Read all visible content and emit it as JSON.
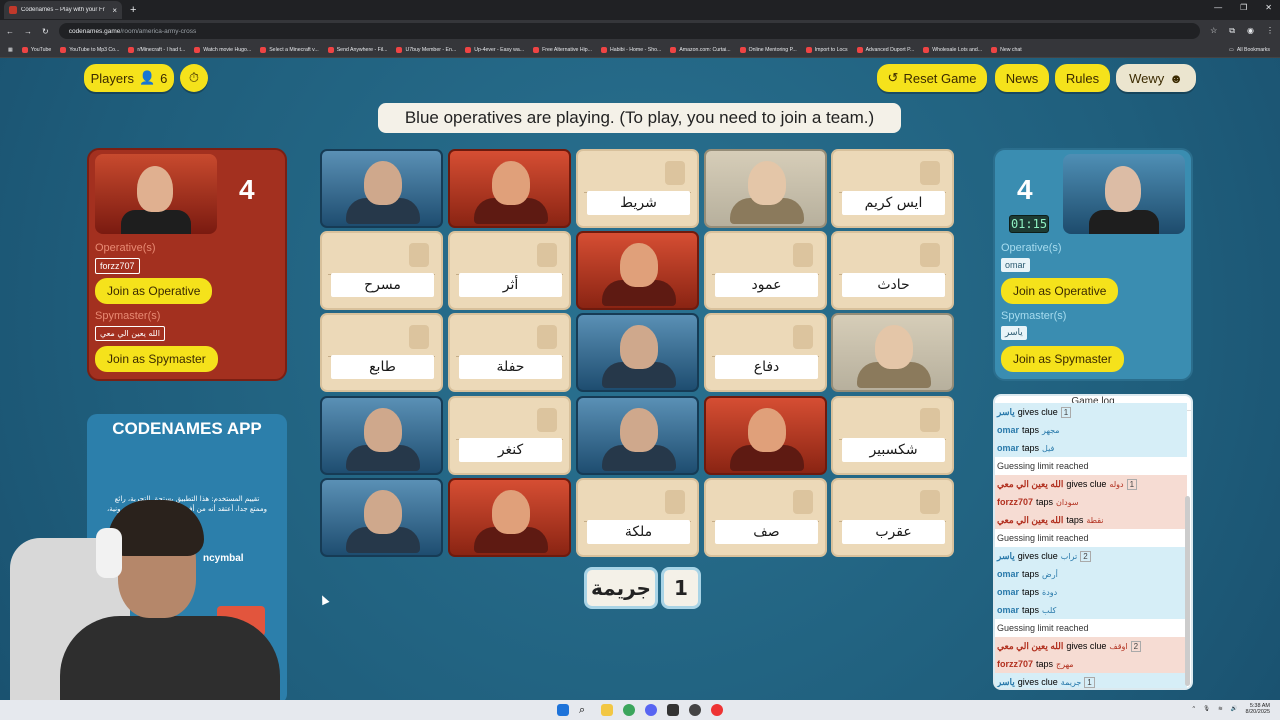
{
  "browser": {
    "tab_title": "Codenames – Play with your Fr",
    "url_host": "codenames.game",
    "url_path": "/room/america-army-cross",
    "bookmarks": [
      "YouTube",
      "YouTube to Mp3 Co...",
      "r/Minecraft - I had t...",
      "Watch movie Hugo...",
      "Select a Minecraft v...",
      "Send Anywhere - Fil...",
      "U7buy Member - En...",
      "Up-4ever - Easy wa...",
      "Free Alternative Hip...",
      "Habibi - Home - Sho...",
      "Amazon.com: Curtai...",
      "Online Mentoring P...",
      "Import to Locs",
      "Advanced Duport P...",
      "Wholesale Lots and...",
      "New chat"
    ],
    "all_bookmarks": "All Bookmarks"
  },
  "header": {
    "players_label": "Players",
    "players_count": "6",
    "reset_label": "Reset Game",
    "news_label": "News",
    "rules_label": "Rules",
    "user_label": "Wewy"
  },
  "status_message": "Blue operatives are playing. (To play, you need to join a team.)",
  "red_team": {
    "score": "4",
    "operatives_label": "Operative(s)",
    "operative": "forzz707",
    "join_operative": "Join as Operative",
    "spymaster_label": "Spymaster(s)",
    "spymaster": "الله يعين الي معي",
    "join_spymaster": "Join as Spymaster"
  },
  "blue_team": {
    "score": "4",
    "timer": "01:15",
    "operatives_label": "Operative(s)",
    "operative": "omar",
    "join_operative": "Join as Operative",
    "spymaster_label": "Spymaster(s)",
    "spymaster": "ياسر",
    "join_spymaster": "Join as Spymaster"
  },
  "app_ad": {
    "title": "CODENAMES APP",
    "description": "تقييم المستخدم: هذا التطبيق يستحق التجربة، رائع وممتع جدا، أعتقد أنه من أفضل ألعاب الورق الإلكترونية، أكثر",
    "credit": "ncymbal"
  },
  "cards": [
    {
      "type": "agent-blue",
      "word": ""
    },
    {
      "type": "agent-red",
      "word": ""
    },
    {
      "type": "word",
      "word": "شريط"
    },
    {
      "type": "bystander",
      "word": ""
    },
    {
      "type": "word",
      "word": "ايس كريم"
    },
    {
      "type": "word",
      "word": "مسرح"
    },
    {
      "type": "word",
      "word": "أثر"
    },
    {
      "type": "agent-red",
      "word": ""
    },
    {
      "type": "word",
      "word": "عمود"
    },
    {
      "type": "word",
      "word": "حادث"
    },
    {
      "type": "word",
      "word": "طابع"
    },
    {
      "type": "word",
      "word": "حفلة"
    },
    {
      "type": "agent-blue",
      "word": ""
    },
    {
      "type": "word",
      "word": "دفاع"
    },
    {
      "type": "bystander",
      "word": ""
    },
    {
      "type": "agent-blue",
      "word": ""
    },
    {
      "type": "word",
      "word": "كنغر"
    },
    {
      "type": "agent-blue",
      "word": ""
    },
    {
      "type": "agent-red",
      "word": ""
    },
    {
      "type": "word",
      "word": "شكسبير"
    },
    {
      "type": "agent-blue",
      "word": ""
    },
    {
      "type": "agent-red",
      "word": ""
    },
    {
      "type": "word",
      "word": "ملكة"
    },
    {
      "type": "word",
      "word": "صف"
    },
    {
      "type": "word",
      "word": "عقرب"
    }
  ],
  "clue": {
    "word": "جريمة",
    "number": "1"
  },
  "game_log": {
    "title": "Game log",
    "entries": [
      {
        "team": "blue",
        "player": "ياسر",
        "action": "gives clue",
        "word": "",
        "num": "1"
      },
      {
        "team": "blue",
        "player": "omar",
        "action": "taps",
        "word": "مجهر",
        "num": ""
      },
      {
        "team": "blue",
        "player": "omar",
        "action": "taps",
        "word": "فيل",
        "num": ""
      },
      {
        "team": "neutral",
        "player": "",
        "action": "Guessing limit reached",
        "word": "",
        "num": ""
      },
      {
        "team": "red",
        "player": "الله يعين الي معي",
        "action": "gives clue",
        "word": "دوله",
        "num": "1"
      },
      {
        "team": "red",
        "player": "forzz707",
        "action": "taps",
        "word": "سودان",
        "num": ""
      },
      {
        "team": "red",
        "player": "الله يعين الي معي",
        "action": "taps",
        "word": "نقطة",
        "num": ""
      },
      {
        "team": "neutral",
        "player": "",
        "action": "Guessing limit reached",
        "word": "",
        "num": ""
      },
      {
        "team": "blue",
        "player": "ياسر",
        "action": "gives clue",
        "word": "تراب",
        "num": "2"
      },
      {
        "team": "blue",
        "player": "omar",
        "action": "taps",
        "word": "أرض",
        "num": ""
      },
      {
        "team": "blue",
        "player": "omar",
        "action": "taps",
        "word": "دودة",
        "num": ""
      },
      {
        "team": "blue",
        "player": "omar",
        "action": "taps",
        "word": "كلب",
        "num": ""
      },
      {
        "team": "neutral",
        "player": "",
        "action": "Guessing limit reached",
        "word": "",
        "num": ""
      },
      {
        "team": "red",
        "player": "الله يعين الي معي",
        "action": "gives clue",
        "word": "اوقف",
        "num": "2"
      },
      {
        "team": "red",
        "player": "forzz707",
        "action": "taps",
        "word": "مهرج",
        "num": ""
      },
      {
        "team": "blue",
        "player": "ياسر",
        "action": "gives clue",
        "word": "جريمة",
        "num": "1"
      }
    ]
  },
  "taskbar": {
    "time": "5:38 AM",
    "date": "8/20/2025"
  }
}
